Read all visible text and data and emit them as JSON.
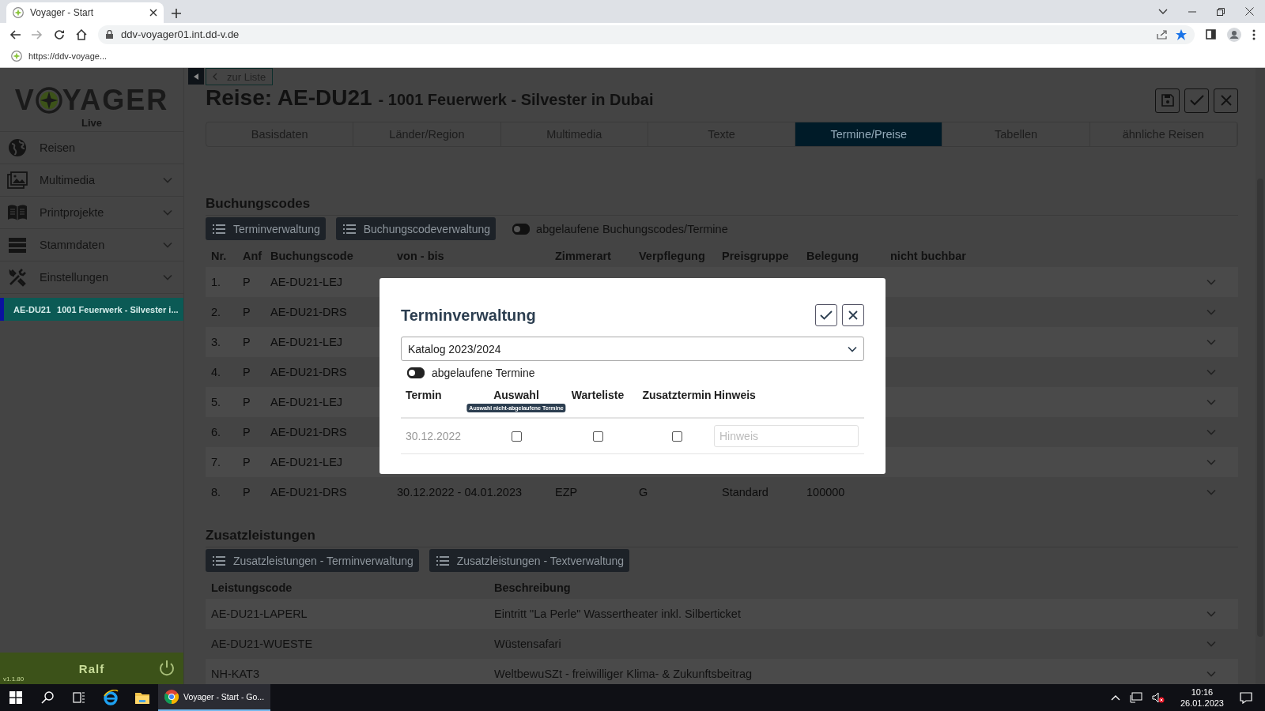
{
  "browser": {
    "tab_title": "Voyager - Start",
    "url": "ddv-voyager01.int.dd-v.de",
    "bookmarks": [
      {
        "label": "https://ddv-voyage..."
      }
    ]
  },
  "sidebar": {
    "logo_start": "V",
    "logo_end": "YAGER",
    "environment": "Live",
    "items": [
      {
        "label": "Reisen",
        "expandable": false
      },
      {
        "label": "Multimedia",
        "expandable": true
      },
      {
        "label": "Printprojekte",
        "expandable": true
      },
      {
        "label": "Stammdaten",
        "expandable": true
      },
      {
        "label": "Einstellungen",
        "expandable": true
      }
    ],
    "open_records": [
      {
        "code": "AE-DU21",
        "title": "1001 Feuerwerk - Silvester i...",
        "selected": true
      }
    ],
    "user": "Ralf",
    "version": "v1.1.80"
  },
  "page": {
    "back_link": "zur Liste",
    "title": "Reise: AE-DU21",
    "subtitle": "- 1001 Feuerwerk - Silvester in Dubai",
    "tabs": [
      {
        "label": "Basisdaten",
        "selected": false
      },
      {
        "label": "Länder/Region",
        "selected": false
      },
      {
        "label": "Multimedia",
        "selected": false
      },
      {
        "label": "Texte",
        "selected": false
      },
      {
        "label": "Termine/Preise",
        "selected": true
      },
      {
        "label": "Tabellen",
        "selected": false
      },
      {
        "label": "ähnliche Reisen",
        "selected": false
      }
    ],
    "booking_codes": {
      "heading": "Buchungscodes",
      "buttons": [
        "Terminverwaltung",
        "Buchungscodeverwaltung"
      ],
      "toggle": {
        "label": "abgelaufene Buchungscodes/Termine",
        "on": false
      },
      "columns": [
        "Nr.",
        "Anf",
        "Buchungscode",
        "von - bis",
        "Zimmerart",
        "Verpflegung",
        "Preisgruppe",
        "Belegung",
        "nicht buchbar"
      ],
      "rows": [
        {
          "cells": [
            "1.",
            "P",
            "AE-DU21-LEJ"
          ]
        },
        {
          "cells": [
            "2.",
            "P",
            "AE-DU21-DRS"
          ]
        },
        {
          "cells": [
            "3.",
            "P",
            "AE-DU21-LEJ"
          ]
        },
        {
          "cells": [
            "4.",
            "P",
            "AE-DU21-DRS"
          ]
        },
        {
          "cells": [
            "5.",
            "P",
            "AE-DU21-LEJ"
          ]
        },
        {
          "cells": [
            "6.",
            "P",
            "AE-DU21-DRS"
          ]
        },
        {
          "cells": [
            "7.",
            "P",
            "AE-DU21-LEJ"
          ]
        },
        {
          "cells": [
            "8.",
            "P",
            "AE-DU21-DRS",
            "30.12.2022 - 04.01.2023",
            "EZP",
            "G",
            "Standard",
            "100000"
          ]
        }
      ]
    },
    "extra_services": {
      "heading": "Zusatzleistungen",
      "buttons": [
        "Zusatzleistungen - Terminverwaltung",
        "Zusatzleistungen - Textverwaltung"
      ],
      "columns": [
        "Leistungscode",
        "Beschreibung"
      ],
      "rows": [
        {
          "cells": [
            "AE-DU21-LAPERL",
            "Eintritt \"La Perle\" Wassertheater inkl. Silberticket"
          ]
        },
        {
          "cells": [
            "AE-DU21-WUESTE",
            "Wüstensafari"
          ]
        },
        {
          "cells": [
            "NH-KAT3",
            "WeltbewuSZt - freiwilliger Klima- & Zukunftsbeitrag"
          ]
        }
      ]
    }
  },
  "dialog": {
    "title": "Terminverwaltung",
    "catalog": "Katalog 2023/2024",
    "toggle": {
      "label": "abgelaufene Termine",
      "on": false
    },
    "columns": [
      "Termin",
      "Auswahl",
      "Warteliste",
      "Zusatztermin",
      "Hinweis"
    ],
    "tooltip": "Auswahl nicht-abgelaufene Termine",
    "rows": [
      {
        "date": "30.12.2022",
        "selection": false,
        "waitlist": false,
        "additional": false,
        "note_placeholder": "Hinweis"
      }
    ]
  },
  "taskbar": {
    "apps": [
      {
        "label": "Voyager - Start - Go...",
        "selected": true
      }
    ],
    "time": "10:16",
    "date": "26.01.2023"
  }
}
